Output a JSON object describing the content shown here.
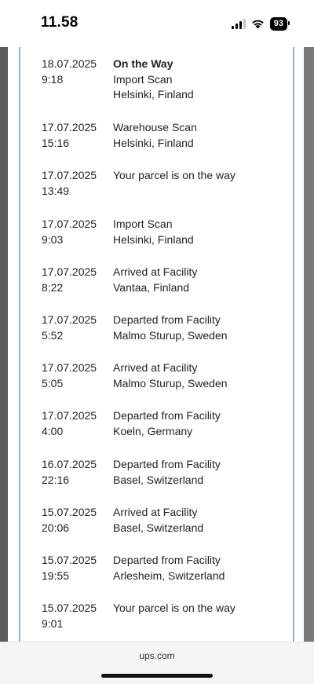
{
  "status_bar": {
    "time": "11.58",
    "battery": "93"
  },
  "tracking": [
    {
      "date": "18.07.2025\n9:18",
      "description": "On the Way\nImport Scan\nHelsinki, Finland",
      "emphasis": true
    },
    {
      "date": "17.07.2025\n15:16",
      "description": "Warehouse Scan\nHelsinki, Finland"
    },
    {
      "date": "17.07.2025\n13:49",
      "description": "Your parcel is on the way"
    },
    {
      "date": "17.07.2025\n9:03",
      "description": "Import Scan\nHelsinki, Finland"
    },
    {
      "date": "17.07.2025\n8:22",
      "description": "Arrived at Facility\nVantaa, Finland"
    },
    {
      "date": "17.07.2025\n5:52",
      "description": "Departed from Facility\nMalmo Sturup, Sweden"
    },
    {
      "date": "17.07.2025\n5:05",
      "description": "Arrived at Facility\nMalmo Sturup, Sweden"
    },
    {
      "date": "17.07.2025\n4:00",
      "description": "Departed from Facility\nKoeln, Germany"
    },
    {
      "date": "16.07.2025\n22:16",
      "description": "Departed from Facility\nBasel, Switzerland"
    },
    {
      "date": "15.07.2025\n20:06",
      "description": "Arrived at Facility\nBasel, Switzerland"
    },
    {
      "date": "15.07.2025\n19:55",
      "description": "Departed from Facility\nArlesheim, Switzerland"
    },
    {
      "date": "15.07.2025\n9:01",
      "description": "Your parcel is on the way"
    }
  ],
  "browser": {
    "url": "ups.com"
  }
}
